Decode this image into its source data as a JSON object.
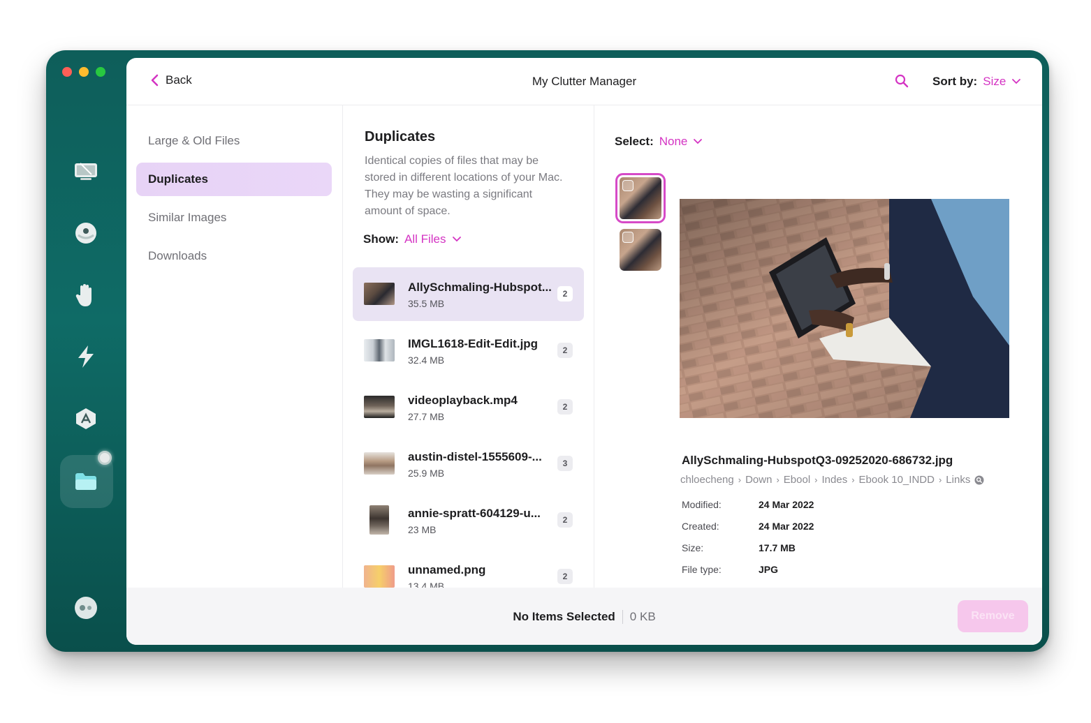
{
  "window": {
    "title": "My Clutter Manager"
  },
  "topbar": {
    "back_label": "Back",
    "sort_label": "Sort by:",
    "sort_value": "Size"
  },
  "sidebar": {
    "items": [
      {
        "label": "Large & Old Files",
        "active": false
      },
      {
        "label": "Duplicates",
        "active": true
      },
      {
        "label": "Similar Images",
        "active": false
      },
      {
        "label": "Downloads",
        "active": false
      }
    ]
  },
  "rail": {
    "icons": [
      "cleanup-icon",
      "protection-icon",
      "hand-icon",
      "speed-icon",
      "apps-icon",
      "files-icon"
    ],
    "bottom_icon": "assistant-icon"
  },
  "main": {
    "title": "Duplicates",
    "description": "Identical copies of files that may be stored in different locations of your Mac. They may be wasting a significant amount of space.",
    "show_label": "Show:",
    "show_value": "All Files",
    "files": [
      {
        "name": "AllySchmaling-Hubspot...",
        "size": "35.5 MB",
        "count": "2",
        "selected": true
      },
      {
        "name": "IMGL1618-Edit-Edit.jpg",
        "size": "32.4 MB",
        "count": "2",
        "selected": false
      },
      {
        "name": "videoplayback.mp4",
        "size": "27.7 MB",
        "count": "2",
        "selected": false
      },
      {
        "name": "austin-distel-1555609-...",
        "size": "25.9 MB",
        "count": "3",
        "selected": false
      },
      {
        "name": "annie-spratt-604129-u...",
        "size": "23 MB",
        "count": "2",
        "selected": false
      },
      {
        "name": "unnamed.png",
        "size": "13.4 MB",
        "count": "2",
        "selected": false
      }
    ]
  },
  "detail": {
    "select_label": "Select:",
    "select_value": "None",
    "file_name": "AllySchmaling-HubspotQ3-09252020-686732.jpg",
    "path": [
      "chloecheng",
      "Down",
      "Ebool",
      "Indes",
      "Ebook 10_INDD",
      "Links"
    ],
    "meta": [
      {
        "key": "Modified:",
        "value": "24 Mar 2022"
      },
      {
        "key": "Created:",
        "value": "24 Mar 2022"
      },
      {
        "key": "Size:",
        "value": "17.7 MB"
      },
      {
        "key": "File type:",
        "value": "JPG"
      }
    ]
  },
  "footer": {
    "status": "No Items Selected",
    "total": "0 KB",
    "remove_label": "Remove"
  },
  "colors": {
    "accent": "#d433c3",
    "sidebar_active": "#e7d3f6",
    "window_bg": "#0f6b66"
  }
}
